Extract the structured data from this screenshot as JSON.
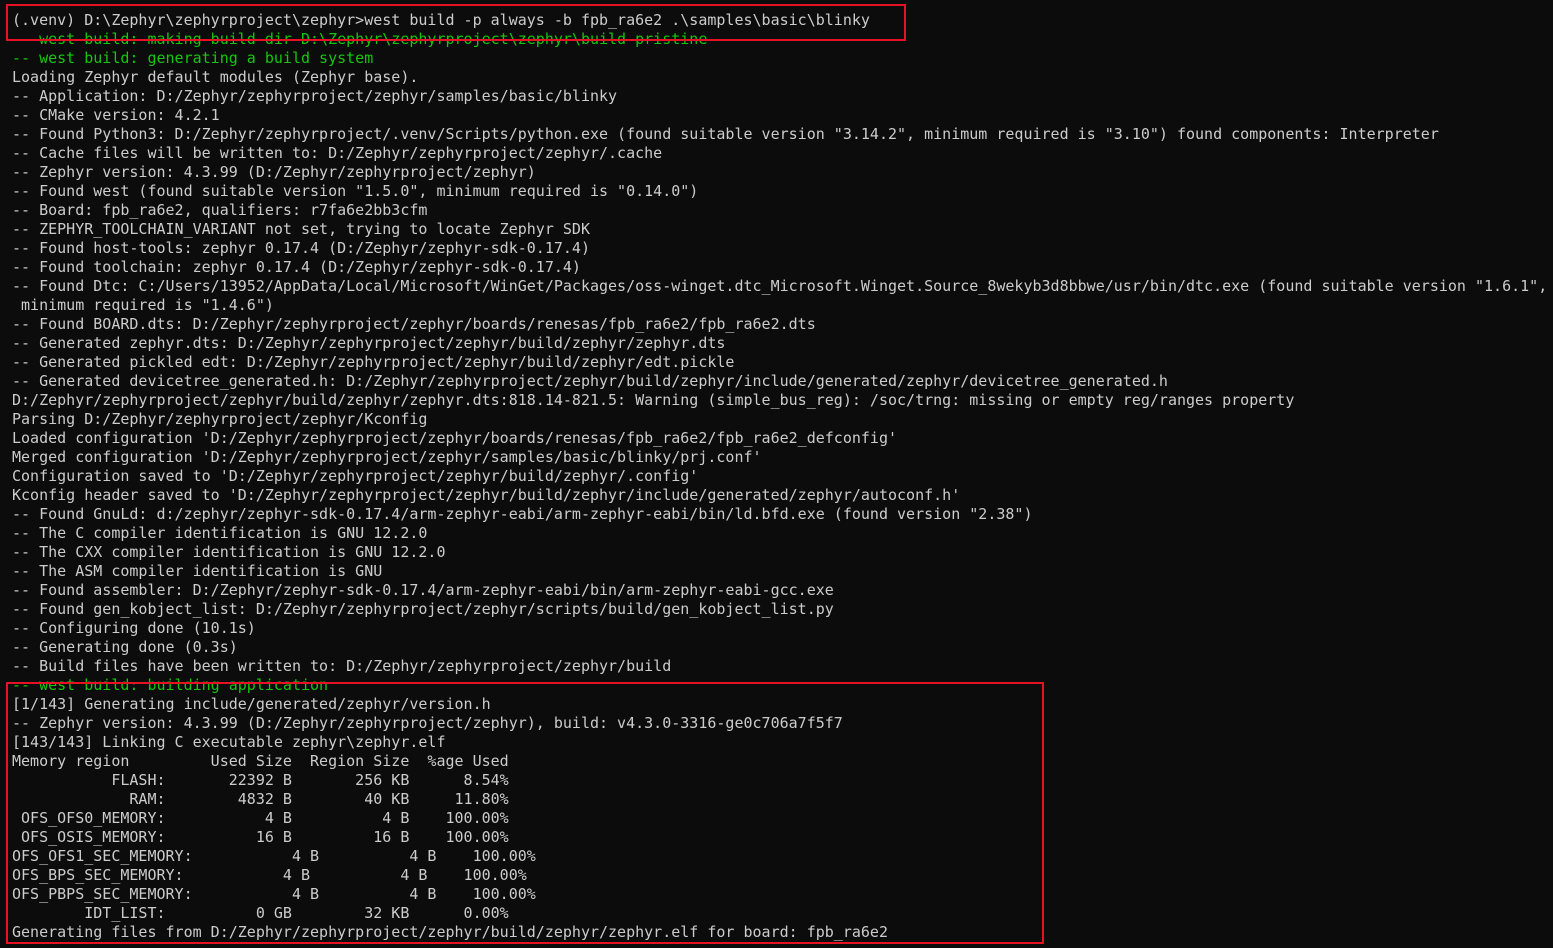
{
  "terminal": {
    "lines": [
      {
        "text": "(.venv) D:\\Zephyr\\zephyrproject\\zephyr>west build -p always -b fpb_ra6e2 .\\samples\\basic\\blinky",
        "color": "#cccccc"
      },
      {
        "text": "-- west build: making build dir D:\\Zephyr\\zephyrproject\\zephyr\\build pristine",
        "color": "#16c60c"
      },
      {
        "text": "-- west build: generating a build system",
        "color": "#16c60c"
      },
      {
        "text": "Loading Zephyr default modules (Zephyr base).",
        "color": "#cccccc"
      },
      {
        "text": "-- Application: D:/Zephyr/zephyrproject/zephyr/samples/basic/blinky",
        "color": "#cccccc"
      },
      {
        "text": "-- CMake version: 4.2.1",
        "color": "#cccccc"
      },
      {
        "text": "-- Found Python3: D:/Zephyr/zephyrproject/.venv/Scripts/python.exe (found suitable version \"3.14.2\", minimum required is \"3.10\") found components: Interpreter",
        "color": "#cccccc"
      },
      {
        "text": "-- Cache files will be written to: D:/Zephyr/zephyrproject/zephyr/.cache",
        "color": "#cccccc"
      },
      {
        "text": "-- Zephyr version: 4.3.99 (D:/Zephyr/zephyrproject/zephyr)",
        "color": "#cccccc"
      },
      {
        "text": "-- Found west (found suitable version \"1.5.0\", minimum required is \"0.14.0\")",
        "color": "#cccccc"
      },
      {
        "text": "-- Board: fpb_ra6e2, qualifiers: r7fa6e2bb3cfm",
        "color": "#cccccc"
      },
      {
        "text": "-- ZEPHYR_TOOLCHAIN_VARIANT not set, trying to locate Zephyr SDK",
        "color": "#cccccc"
      },
      {
        "text": "-- Found host-tools: zephyr 0.17.4 (D:/Zephyr/zephyr-sdk-0.17.4)",
        "color": "#cccccc"
      },
      {
        "text": "-- Found toolchain: zephyr 0.17.4 (D:/Zephyr/zephyr-sdk-0.17.4)",
        "color": "#cccccc"
      },
      {
        "text": "-- Found Dtc: C:/Users/13952/AppData/Local/Microsoft/WinGet/Packages/oss-winget.dtc_Microsoft.Winget.Source_8wekyb3d8bbwe/usr/bin/dtc.exe (found suitable version \"1.6.1\",",
        "color": "#cccccc"
      },
      {
        "text": " minimum required is \"1.4.6\")",
        "color": "#cccccc"
      },
      {
        "text": "-- Found BOARD.dts: D:/Zephyr/zephyrproject/zephyr/boards/renesas/fpb_ra6e2/fpb_ra6e2.dts",
        "color": "#cccccc"
      },
      {
        "text": "-- Generated zephyr.dts: D:/Zephyr/zephyrproject/zephyr/build/zephyr/zephyr.dts",
        "color": "#cccccc"
      },
      {
        "text": "-- Generated pickled edt: D:/Zephyr/zephyrproject/zephyr/build/zephyr/edt.pickle",
        "color": "#cccccc"
      },
      {
        "text": "-- Generated devicetree_generated.h: D:/Zephyr/zephyrproject/zephyr/build/zephyr/include/generated/zephyr/devicetree_generated.h",
        "color": "#cccccc"
      },
      {
        "text": "D:/Zephyr/zephyrproject/zephyr/build/zephyr/zephyr.dts:818.14-821.5: Warning (simple_bus_reg): /soc/trng: missing or empty reg/ranges property",
        "color": "#cccccc"
      },
      {
        "text": "Parsing D:/Zephyr/zephyrproject/zephyr/Kconfig",
        "color": "#cccccc"
      },
      {
        "text": "Loaded configuration 'D:/Zephyr/zephyrproject/zephyr/boards/renesas/fpb_ra6e2/fpb_ra6e2_defconfig'",
        "color": "#cccccc"
      },
      {
        "text": "Merged configuration 'D:/Zephyr/zephyrproject/zephyr/samples/basic/blinky/prj.conf'",
        "color": "#cccccc"
      },
      {
        "text": "Configuration saved to 'D:/Zephyr/zephyrproject/zephyr/build/zephyr/.config'",
        "color": "#cccccc"
      },
      {
        "text": "Kconfig header saved to 'D:/Zephyr/zephyrproject/zephyr/build/zephyr/include/generated/zephyr/autoconf.h'",
        "color": "#cccccc"
      },
      {
        "text": "-- Found GnuLd: d:/zephyr/zephyr-sdk-0.17.4/arm-zephyr-eabi/arm-zephyr-eabi/bin/ld.bfd.exe (found version \"2.38\")",
        "color": "#cccccc"
      },
      {
        "text": "-- The C compiler identification is GNU 12.2.0",
        "color": "#cccccc"
      },
      {
        "text": "-- The CXX compiler identification is GNU 12.2.0",
        "color": "#cccccc"
      },
      {
        "text": "-- The ASM compiler identification is GNU",
        "color": "#cccccc"
      },
      {
        "text": "-- Found assembler: D:/Zephyr/zephyr-sdk-0.17.4/arm-zephyr-eabi/bin/arm-zephyr-eabi-gcc.exe",
        "color": "#cccccc"
      },
      {
        "text": "-- Found gen_kobject_list: D:/Zephyr/zephyrproject/zephyr/scripts/build/gen_kobject_list.py",
        "color": "#cccccc"
      },
      {
        "text": "-- Configuring done (10.1s)",
        "color": "#cccccc"
      },
      {
        "text": "-- Generating done (0.3s)",
        "color": "#cccccc"
      },
      {
        "text": "-- Build files have been written to: D:/Zephyr/zephyrproject/zephyr/build",
        "color": "#cccccc"
      },
      {
        "text": "-- west build: building application",
        "color": "#16c60c"
      },
      {
        "text": "[1/143] Generating include/generated/zephyr/version.h",
        "color": "#cccccc"
      },
      {
        "text": "-- Zephyr version: 4.3.99 (D:/Zephyr/zephyrproject/zephyr), build: v4.3.0-3316-ge0c706a7f5f7",
        "color": "#cccccc"
      },
      {
        "text": "[143/143] Linking C executable zephyr\\zephyr.elf",
        "color": "#cccccc"
      },
      {
        "text": "Memory region         Used Size  Region Size  %age Used",
        "color": "#cccccc"
      },
      {
        "text": "           FLASH:       22392 B       256 KB      8.54%",
        "color": "#cccccc"
      },
      {
        "text": "             RAM:        4832 B        40 KB     11.80%",
        "color": "#cccccc"
      },
      {
        "text": " OFS_OFS0_MEMORY:           4 B          4 B    100.00%",
        "color": "#cccccc"
      },
      {
        "text": " OFS_OSIS_MEMORY:          16 B         16 B    100.00%",
        "color": "#cccccc"
      },
      {
        "text": "OFS_OFS1_SEC_MEMORY:           4 B          4 B    100.00%",
        "color": "#cccccc"
      },
      {
        "text": "OFS_BPS_SEC_MEMORY:           4 B          4 B    100.00%",
        "color": "#cccccc"
      },
      {
        "text": "OFS_PBPS_SEC_MEMORY:           4 B          4 B    100.00%",
        "color": "#cccccc"
      },
      {
        "text": "        IDT_LIST:          0 GB        32 KB      0.00%",
        "color": "#cccccc"
      },
      {
        "text": "Generating files from D:/Zephyr/zephyrproject/zephyr/build/zephyr/zephyr.elf for board: fpb_ra6e2",
        "color": "#cccccc"
      }
    ],
    "highlight_color": "#e81123",
    "background_color": "#0c0c0c"
  }
}
